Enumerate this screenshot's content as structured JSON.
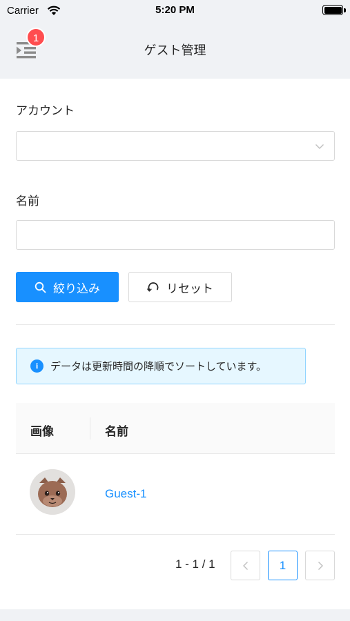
{
  "status_bar": {
    "carrier": "Carrier",
    "time": "5:20 PM"
  },
  "navbar": {
    "title": "ゲスト管理",
    "badge_count": "1"
  },
  "form": {
    "account_label": "アカウント",
    "account_value": "",
    "name_label": "名前",
    "name_value": "",
    "filter_button": "絞り込み",
    "reset_button": "リセット"
  },
  "alert": {
    "text": "データは更新時間の降順でソートしています。"
  },
  "table": {
    "columns": [
      "画像",
      "名前"
    ],
    "rows": [
      {
        "name": "Guest-1"
      }
    ]
  },
  "pagination": {
    "info": "1 - 1 / 1",
    "current_page": "1"
  },
  "colors": {
    "primary": "#1890ff",
    "badge": "#ff4d4f",
    "header_bg": "#f0f2f5",
    "alert_bg": "#e6f7ff"
  }
}
